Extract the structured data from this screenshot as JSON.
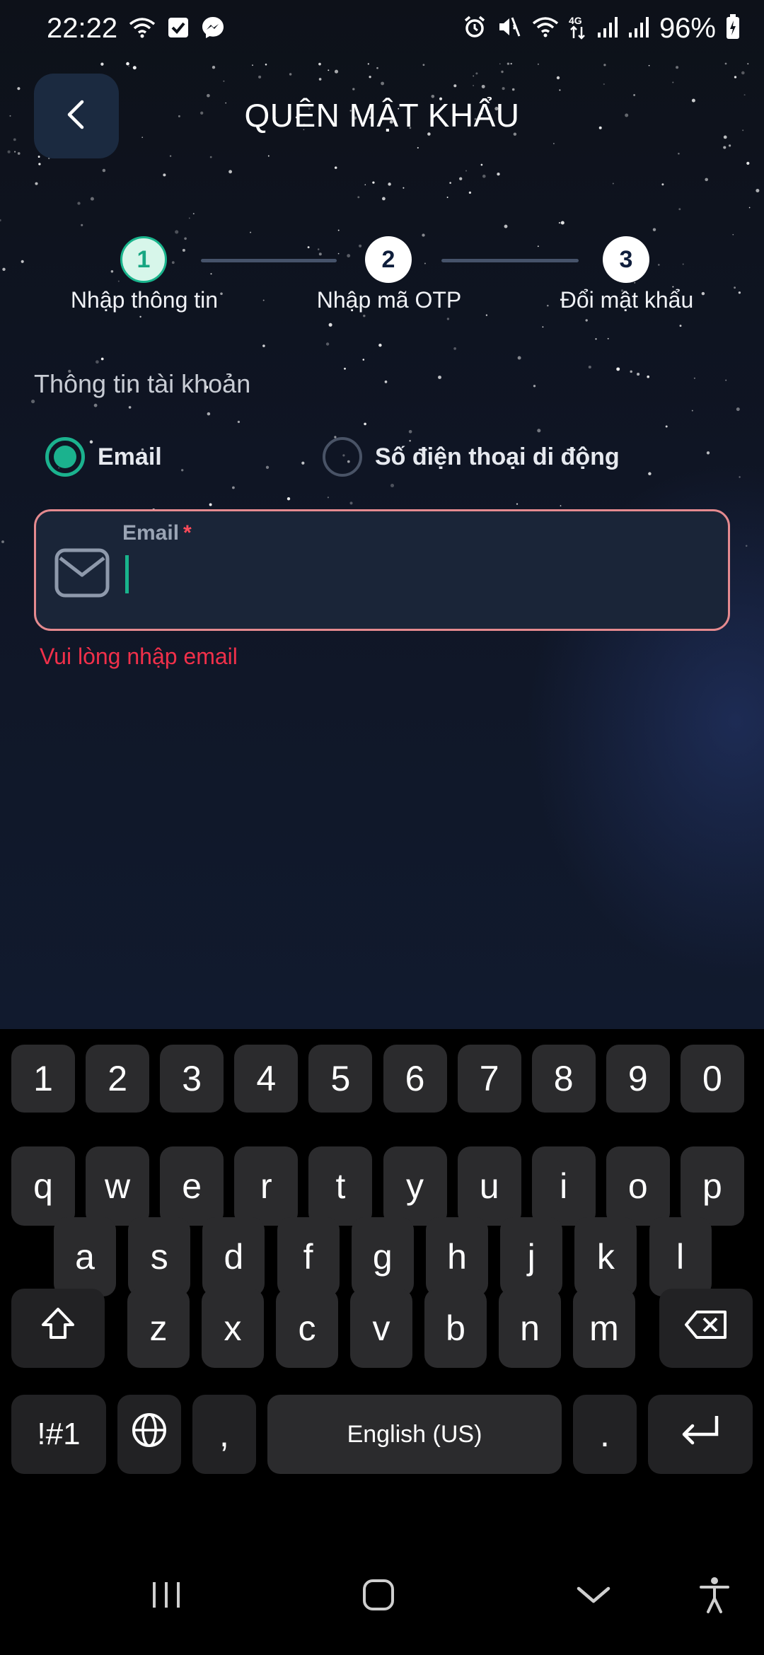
{
  "status_bar": {
    "time": "22:22",
    "left_icons": [
      "wifi-question-icon",
      "check-box-icon",
      "messenger-icon"
    ],
    "right_icons": [
      "alarm-icon",
      "mute-icon",
      "wifi-icon",
      "4g-icon",
      "signal-icon",
      "signal-icon",
      "battery-icon"
    ],
    "battery": "96%"
  },
  "header": {
    "back_icon": "chevron-left-icon",
    "title": "QUÊN MẬT KHẨU"
  },
  "stepper": {
    "steps": [
      {
        "number": "1",
        "label": "Nhập thông tin",
        "state": "active"
      },
      {
        "number": "2",
        "label": "Nhập mã OTP",
        "state": "pending"
      },
      {
        "number": "3",
        "label": "Đổi mật khẩu",
        "state": "pending"
      }
    ]
  },
  "form": {
    "section_label": "Thông tin tài khoản",
    "options": [
      {
        "label": "Email",
        "selected": true
      },
      {
        "label": "Số điện thoại di động",
        "selected": false
      }
    ],
    "email_field": {
      "label": "Email",
      "required_mark": "*",
      "value": "",
      "icon": "envelope-icon",
      "error": "Vui lòng nhập email"
    }
  },
  "keyboard": {
    "row_numbers": [
      "1",
      "2",
      "3",
      "4",
      "5",
      "6",
      "7",
      "8",
      "9",
      "0"
    ],
    "row_top": [
      "q",
      "w",
      "e",
      "r",
      "t",
      "y",
      "u",
      "i",
      "o",
      "p"
    ],
    "row_middle": [
      "a",
      "s",
      "d",
      "f",
      "g",
      "h",
      "j",
      "k",
      "l"
    ],
    "row_bottom": [
      "z",
      "x",
      "c",
      "v",
      "b",
      "n",
      "m"
    ],
    "symbols_key": "!#1",
    "comma_key": ",",
    "space_key": "English (US)",
    "period_key": ".",
    "icons": {
      "shift": "shift-icon",
      "backspace": "backspace-icon",
      "globe": "globe-icon",
      "enter": "enter-icon"
    }
  },
  "nav_bar": {
    "icons": [
      "recent-apps-icon",
      "home-icon",
      "hide-keyboard-icon",
      "accessibility-icon"
    ]
  },
  "colors": {
    "accent": "#19b48c",
    "error": "#f0304a",
    "error_border": "#e58a8f",
    "field_bg": "#1a2538"
  }
}
